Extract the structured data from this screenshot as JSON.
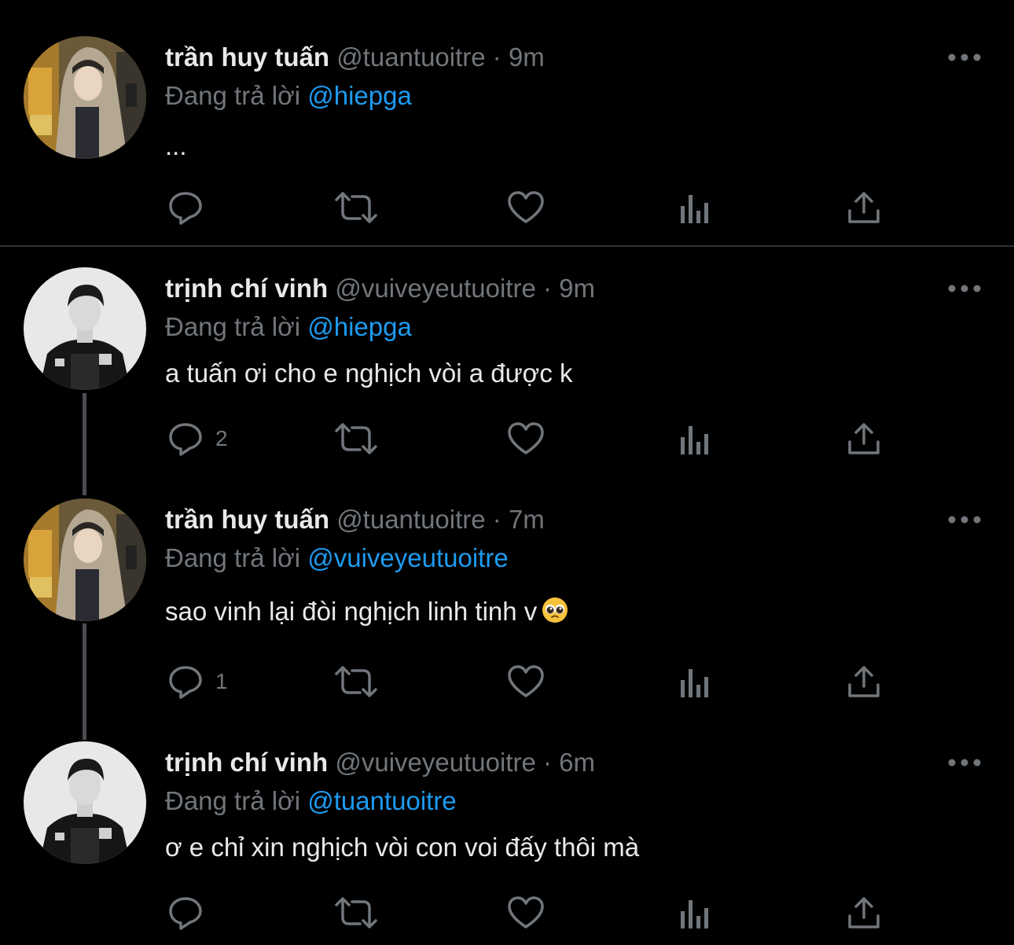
{
  "tweets": [
    {
      "name": "trần huy tuấn",
      "meta": "@tuantuoitre · 9m",
      "reply_prefix": "Đang trả lời",
      "reply_to": "@hiepga",
      "text": "...",
      "reply_count": "",
      "avatar_icon": "avatar-hooded-person",
      "more_icon": "more-dots-icon"
    },
    {
      "name": "trịnh chí vinh",
      "meta": "@vuiveyeutuoitre · 9m",
      "reply_prefix": "Đang trả lời",
      "reply_to": "@hiepga",
      "text": "a tuấn ơi cho e nghịch vòi a được k",
      "reply_count": "2",
      "avatar_icon": "avatar-monochrome-person",
      "more_icon": "more-dots-icon"
    },
    {
      "name": "trần huy tuấn",
      "meta": "@tuantuoitre · 7m",
      "reply_prefix": "Đang trả lời",
      "reply_to": "@vuiveyeutuoitre",
      "text": "sao vinh lại đòi nghịch linh tinh v",
      "emoji": "pleading-face-emoji",
      "reply_count": "1",
      "avatar_icon": "avatar-hooded-person",
      "more_icon": "more-dots-icon"
    },
    {
      "name": "trịnh chí vinh",
      "meta": "@vuiveyeutuoitre · 6m",
      "reply_prefix": "Đang trả lời",
      "reply_to": "@tuantuoitre",
      "text": "ơ e chỉ xin nghịch vòi con voi đấy thôi mà",
      "reply_count": "",
      "avatar_icon": "avatar-monochrome-person",
      "more_icon": "more-dots-icon"
    }
  ],
  "action_icons": [
    "reply-icon",
    "retweet-icon",
    "like-icon",
    "analytics-icon",
    "share-icon"
  ],
  "colors": {
    "background": "#000000",
    "text": "#e7e9ea",
    "muted": "#71767b",
    "mention": "#1d9bf0",
    "divider": "#2f3336"
  }
}
